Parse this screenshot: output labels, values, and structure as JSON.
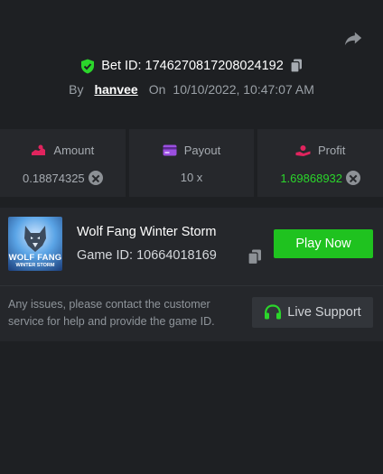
{
  "header": {
    "bet_id_label": "Bet ID: 1746270817208024192",
    "by_label": "By",
    "username": "hanvee",
    "on_label": "On",
    "datetime": "10/10/2022, 10:47:07 AM"
  },
  "stats": {
    "amount": {
      "label": "Amount",
      "value": "0.18874325"
    },
    "payout": {
      "label": "Payout",
      "value": "10 x"
    },
    "profit": {
      "label": "Profit",
      "value": "1.69868932"
    }
  },
  "game": {
    "thumb_title": "WOLF FANG",
    "thumb_subtitle": "WINTER STORM",
    "name": "Wolf Fang Winter Storm",
    "game_id": "Game ID: 10664018169",
    "play_label": "Play Now"
  },
  "support": {
    "note": "Any issues, please contact the customer service for help and provide the game ID.",
    "live_label": "Live Support"
  },
  "colors": {
    "background": "#1e2023",
    "profit": "#2bd62b",
    "play_button": "#1fc21f",
    "amount_icon": "#e0245e",
    "payout_icon": "#9b4fe0",
    "shield": "#2bd62b"
  },
  "icons": [
    "share-icon",
    "shield-check-icon",
    "copy-icon",
    "amount-icon",
    "payout-icon",
    "profit-icon",
    "x-circle-icon",
    "headset-icon"
  ]
}
